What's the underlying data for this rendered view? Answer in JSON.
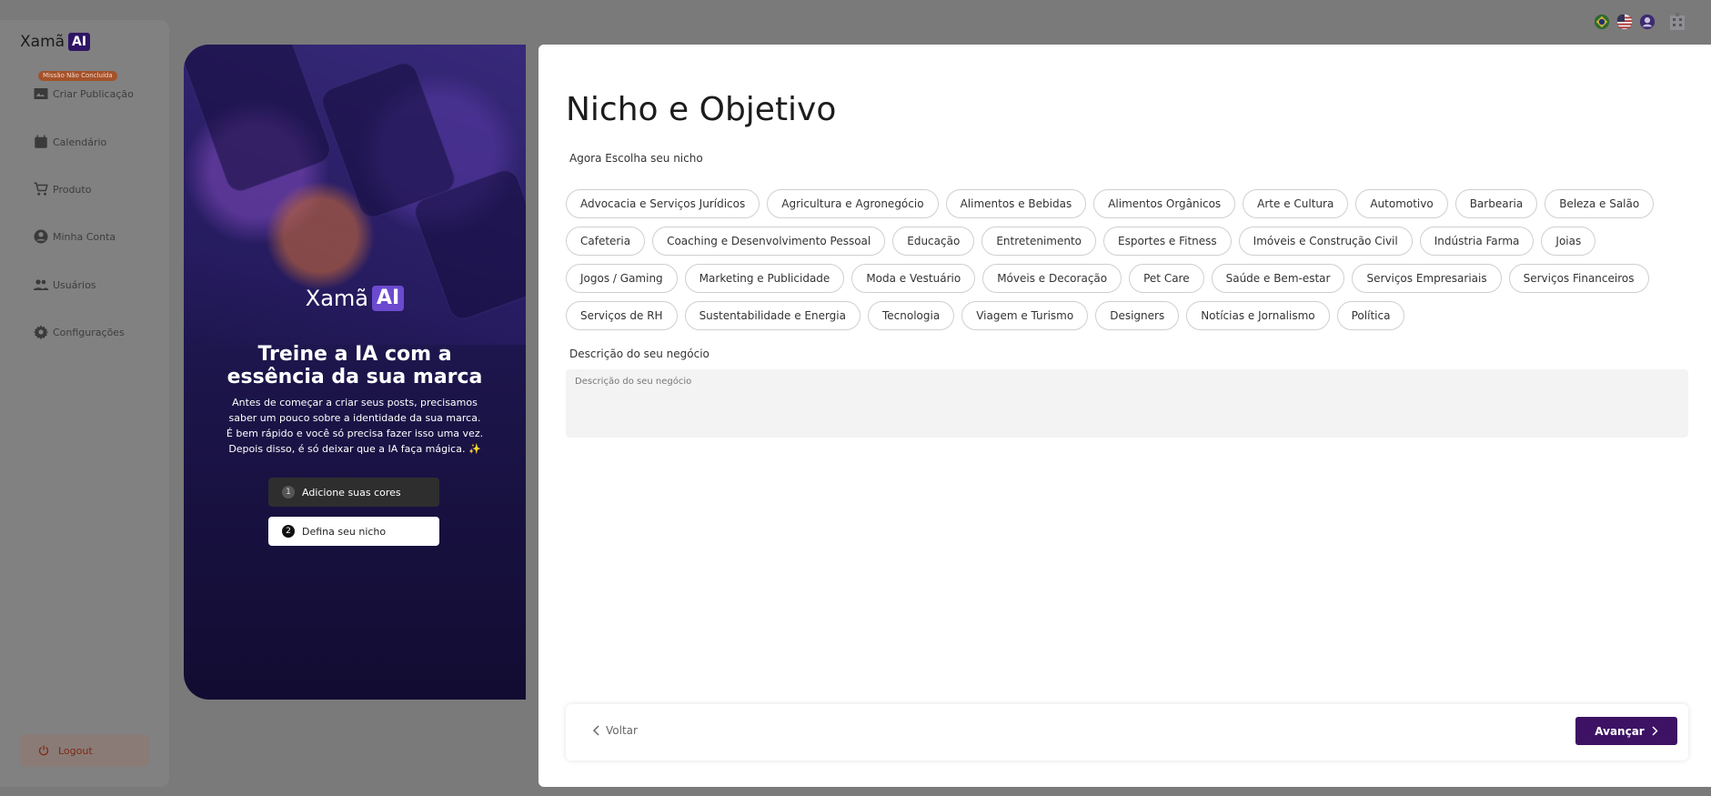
{
  "sidebar": {
    "logo_text": "Xamã",
    "logo_ai": "AI",
    "mission_badge": "Missão Não Concluída",
    "items": [
      {
        "label": "Criar Publicação",
        "icon": "image-icon"
      },
      {
        "label": "Calendário",
        "icon": "calendar-icon"
      },
      {
        "label": "Produto",
        "icon": "cart-icon"
      },
      {
        "label": "Minha Conta",
        "icon": "user-icon"
      },
      {
        "label": "Usuários",
        "icon": "users-icon"
      },
      {
        "label": "Configurações",
        "icon": "gear-icon"
      }
    ],
    "logout_label": "Logout"
  },
  "hero": {
    "logo_text": "Xamã",
    "logo_ai": "AI",
    "title_line1": "Treine a IA com a",
    "title_line2": "essência da sua marca",
    "text_line1": "Antes de começar a criar seus posts, precisamos",
    "text_line2": "saber um pouco sobre a identidade da sua marca.",
    "text_line3": "É bem rápido e você só precisa fazer isso uma vez.",
    "text_line4": "Depois disso, é só deixar que a IA faça mágica. ✨",
    "steps": [
      {
        "num": "1",
        "label": "Adicione suas cores"
      },
      {
        "num": "2",
        "label": "Defina seu nicho"
      }
    ]
  },
  "main": {
    "title": "Nicho e Objetivo",
    "subtitle": "Agora Escolha seu nicho",
    "niches": [
      [
        "Advocacia e Serviços Jurídicos",
        "Agricultura e Agronegócio",
        "Alimentos e Bebidas",
        "Alimentos Orgânicos",
        "Arte e Cultura",
        "Automotivo",
        "Barbearia",
        "Beleza e Salão"
      ],
      [
        "Cafeteria",
        "Coaching e Desenvolvimento Pessoal",
        "Educação",
        "Entretenimento",
        "Esportes e Fitness",
        "Imóveis e Construção Civil",
        "Indústria Farma",
        "Joias"
      ],
      [
        "Jogos / Gaming",
        "Marketing e Publicidade",
        "Moda e Vestuário",
        "Móveis e Decoração",
        "Pet Care",
        "Saúde e Bem-estar",
        "Serviços Empresariais",
        "Serviços Financeiros"
      ],
      [
        "Serviços de RH",
        "Sustentabilidade e Energia",
        "Tecnologia",
        "Viagem e Turismo",
        "Designers",
        "Notícias e Jornalismo",
        "Política"
      ]
    ],
    "description_label": "Descrição do seu negócio",
    "description_placeholder": "Descrição do seu negócio",
    "description_value": "",
    "back_label": "Voltar",
    "next_label": "Avançar"
  },
  "colors": {
    "accent": "#3d1264",
    "logout_text": "#7d2a12"
  }
}
